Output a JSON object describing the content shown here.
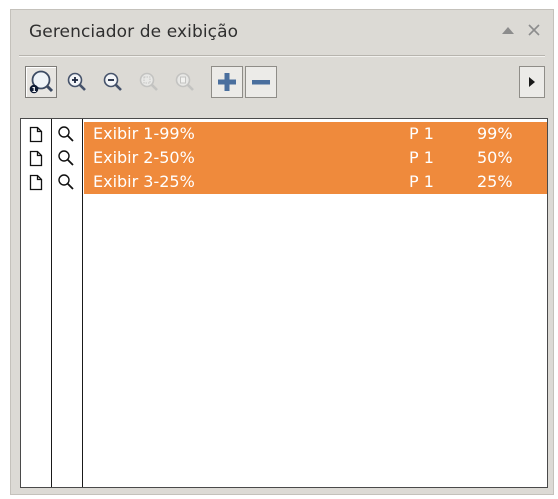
{
  "panel": {
    "title": "Gerenciador de exibição",
    "collapse_icon": "triangle-up-icon",
    "close_icon": "close-icon"
  },
  "toolbar": {
    "buttons": [
      {
        "name": "zoom-one-shot-icon"
      },
      {
        "name": "zoom-in-icon"
      },
      {
        "name": "zoom-out-icon"
      },
      {
        "name": "zoom-selected-icon"
      },
      {
        "name": "zoom-to-page-icon"
      },
      {
        "name": "add-view-icon"
      },
      {
        "name": "remove-view-icon"
      }
    ],
    "flyout_icon": "triangle-right-icon"
  },
  "views": [
    {
      "name": "Exibir 1-99%",
      "page": "P 1",
      "zoom": "99%"
    },
    {
      "name": "Exibir 2-50%",
      "page": "P 1",
      "zoom": "50%"
    },
    {
      "name": "Exibir 3-25%",
      "page": "P 1",
      "zoom": "25%"
    }
  ],
  "colors": {
    "highlight": "#ef8a3c",
    "panel_bg": "#dcdad5",
    "add_icon": "#4a6f9e"
  }
}
